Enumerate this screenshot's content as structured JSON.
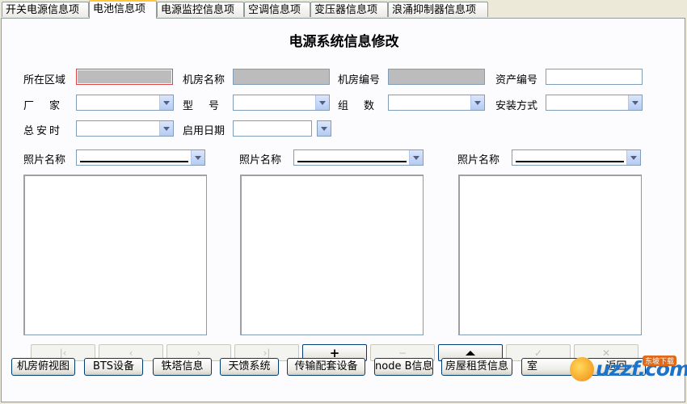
{
  "tabs": [
    "开关电源信息项",
    "电池信息项",
    "电源监控信息项",
    "空调信息项",
    "变压器信息项",
    "浪涌抑制器信息项"
  ],
  "active_tab": 1,
  "form": {
    "title": "电源系统信息修改",
    "region_label": "所在区域",
    "room_name_label": "机房名称",
    "room_no_label": "机房编号",
    "asset_no_label": "资产编号",
    "vendor_label": "厂　家",
    "model_label": "型　号",
    "group_label": "组　数",
    "install_label": "安装方式",
    "total_ah_label": "总安时",
    "start_date_label": "启用日期"
  },
  "photos": {
    "label": "照片名称"
  },
  "bottom_buttons": [
    "机房俯视图",
    "BTS设备",
    "铁塔信息",
    "天馈系统",
    "传输配套设备",
    "node B信息",
    "房屋租赁信息",
    "室",
    "返回"
  ],
  "logo": {
    "text": "uzzf.com",
    "badge": "东坡下载"
  },
  "colors": {
    "accent": "#ffc83c",
    "border": "#7f9db9",
    "focus": "#e04343"
  }
}
